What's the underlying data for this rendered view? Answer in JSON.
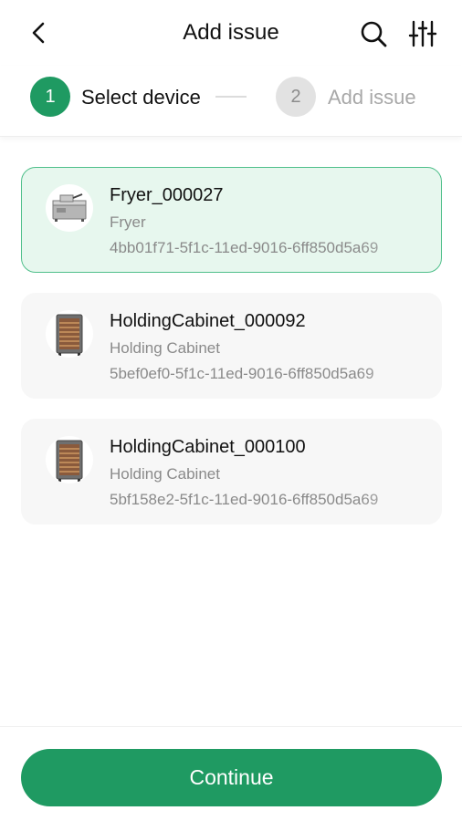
{
  "header": {
    "title": "Add issue",
    "back_icon": "chevron-left-icon",
    "search_icon": "search-icon",
    "filter_icon": "sliders-icon"
  },
  "stepper": {
    "steps": [
      {
        "number": "1",
        "label": "Select device",
        "state": "active"
      },
      {
        "number": "2",
        "label": "Add issue",
        "state": "inactive"
      }
    ]
  },
  "devices": [
    {
      "name": "Fryer_000027",
      "type": "Fryer",
      "id": "4bb01f71-5f1c-11ed-9016-6ff850d5a69",
      "icon": "fryer-icon",
      "selected": true
    },
    {
      "name": "HoldingCabinet_000092",
      "type": "Holding Cabinet",
      "id": "5bef0ef0-5f1c-11ed-9016-6ff850d5a69",
      "icon": "holding-cabinet-icon",
      "selected": false
    },
    {
      "name": "HoldingCabinet_000100",
      "type": "Holding Cabinet",
      "id": "5bf158e2-5f1c-11ed-9016-6ff850d5a69",
      "icon": "holding-cabinet-icon",
      "selected": false
    }
  ],
  "footer": {
    "continue_label": "Continue"
  },
  "colors": {
    "accent": "#1f9a62",
    "selected_card_bg": "#e7f7ee",
    "selected_card_border": "#4fbf8a",
    "card_bg": "#f7f7f7",
    "inactive_step": "#e2e2e2"
  }
}
